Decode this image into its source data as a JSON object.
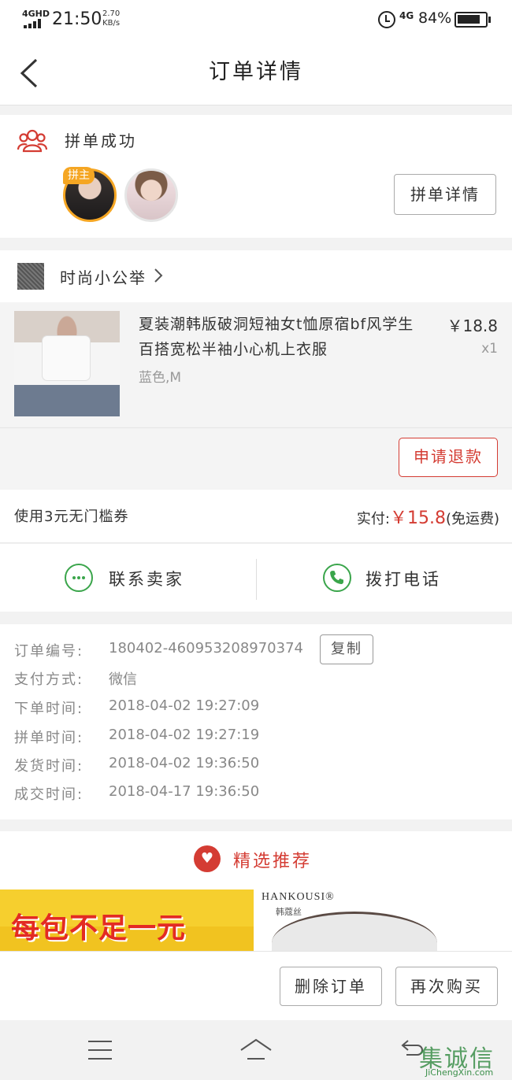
{
  "status_bar": {
    "network": "4GHD",
    "time": "21:50",
    "speed_value": "2.70",
    "speed_unit": "KB/s",
    "network_right": "4G",
    "battery": "84%",
    "battery_level": 0.84
  },
  "header": {
    "title": "订单详情",
    "back_icon": "back-arrow-icon"
  },
  "group": {
    "status": "拼单成功",
    "icon": "group-people-icon",
    "leader_badge": "拼主",
    "detail_button": "拼单详情"
  },
  "shop": {
    "name": "时尚小公举"
  },
  "product": {
    "title": "夏装潮韩版破洞短袖女t恤原宿bf风学生百搭宽松半袖小心机上衣服",
    "spec": "蓝色,M",
    "price": "￥18.8",
    "quantity": "x1",
    "refund_button": "申请退款"
  },
  "payment": {
    "coupon": "使用3元无门槛券",
    "paid_label": "实付:",
    "paid_amount": "￥15.8",
    "shipping": "(免运费)"
  },
  "contact": {
    "seller_label": "联系卖家",
    "call_label": "拨打电话",
    "seller_icon": "chat-icon",
    "call_icon": "phone-icon"
  },
  "order_info": {
    "copy_button": "复制",
    "rows": [
      {
        "label": "订单编号:",
        "value": "180402-460953208970374"
      },
      {
        "label": "支付方式:",
        "value": "微信"
      },
      {
        "label": "下单时间:",
        "value": "2018-04-02 19:27:09"
      },
      {
        "label": "拼单时间:",
        "value": "2018-04-02 19:27:19"
      },
      {
        "label": "发货时间:",
        "value": "2018-04-02 19:36:50"
      },
      {
        "label": "成交时间:",
        "value": "2018-04-17 19:36:50"
      }
    ]
  },
  "recommend": {
    "title": "精选推荐",
    "item1_text": "每包不足一元",
    "item2_brand": "HANKOUSI®",
    "item2_brand_sub": "韩蔻丝"
  },
  "actions": {
    "delete": "删除订单",
    "rebuy": "再次购买"
  },
  "watermark": {
    "text": "集诚信",
    "url": "JiChengXin.com"
  },
  "colors": {
    "accent": "#d43c33",
    "green": "#3aa54b",
    "leader": "#f5a623"
  }
}
